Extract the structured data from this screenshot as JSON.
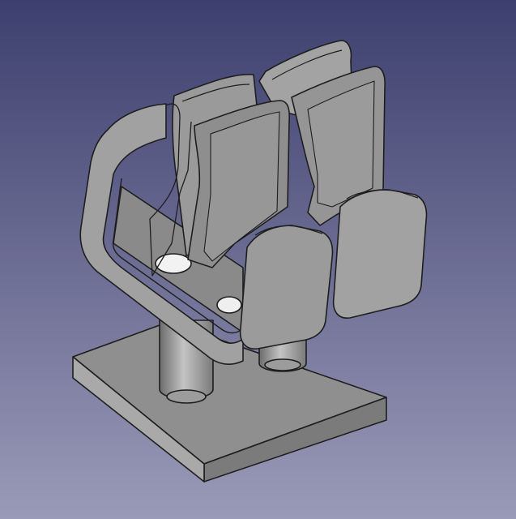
{
  "viewport": {
    "background_top": "#3d3f6e",
    "background_bottom": "#9a9ab8",
    "model_fill": "#8d8d8d",
    "model_edge": "#1e1e1e",
    "model_light": "#b4b4b4",
    "model_dark": "#6c6c6c"
  },
  "model": {
    "parts": [
      "base-plate",
      "mounting-post-left",
      "mounting-post-right",
      "cradle-frame",
      "clip-front-left",
      "clip-back-left",
      "clip-front-right",
      "clip-back-right",
      "end-pad-left",
      "end-pad-right"
    ]
  }
}
